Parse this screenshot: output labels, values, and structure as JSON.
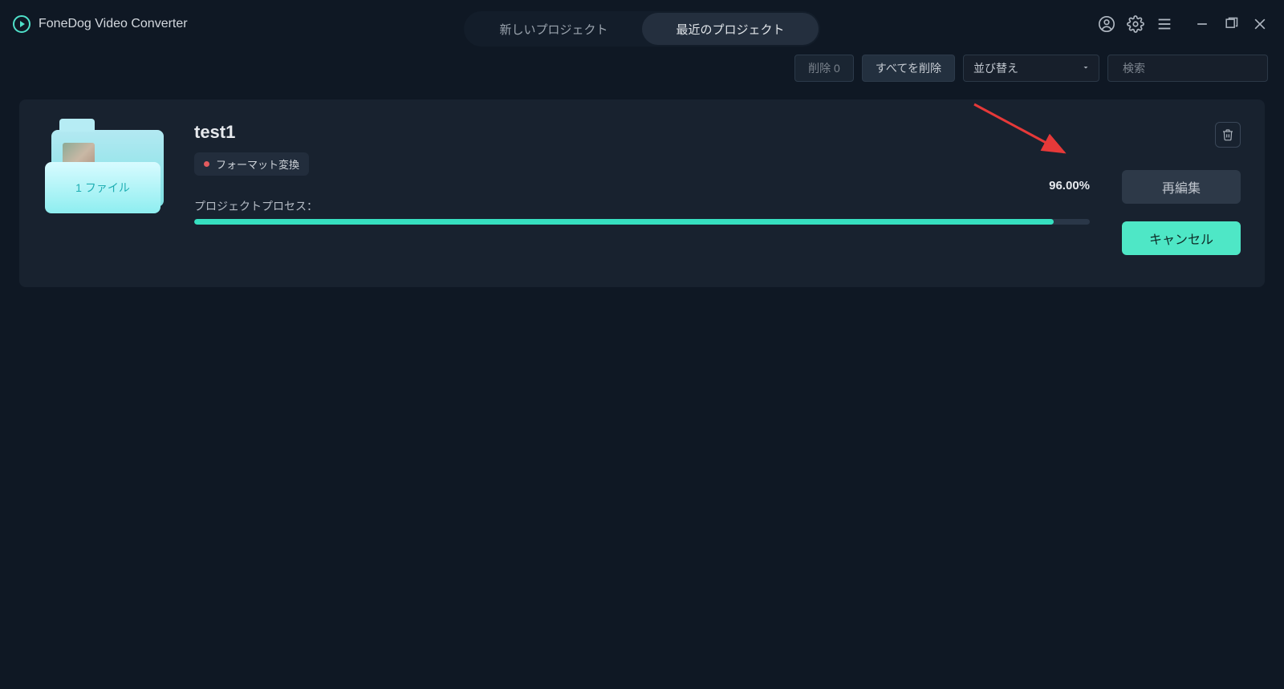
{
  "app_title": "FoneDog Video Converter",
  "tabs": {
    "new_project": "新しいプロジェクト",
    "recent_projects": "最近のプロジェクト"
  },
  "toolbar": {
    "delete_n": "削除 0",
    "delete_all": "すべてを削除",
    "sort_label": "並び替え",
    "search_placeholder": "検索"
  },
  "project": {
    "title": "test1",
    "badge": "フォーマット変換",
    "file_count_label": "1 ファイル",
    "process_label": "プロジェクトプロセス：",
    "percent_text": "96.00%",
    "percent_value": 96,
    "reedit_label": "再編集",
    "cancel_label": "キャンセル"
  }
}
